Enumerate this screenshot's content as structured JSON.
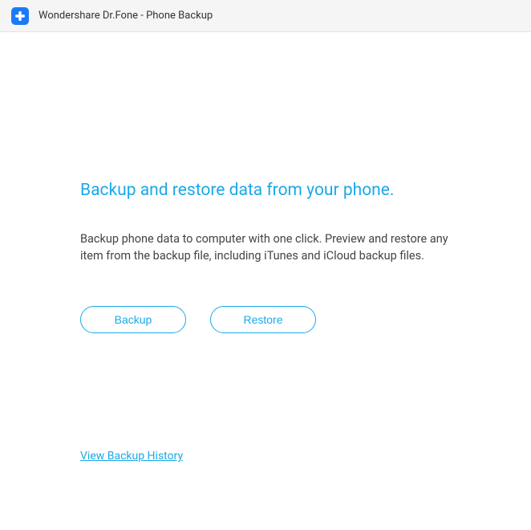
{
  "titlebar": {
    "app_title": "Wondershare Dr.Fone - Phone Backup"
  },
  "main": {
    "heading": "Backup and restore data from your phone.",
    "description": "Backup phone data to computer with one click. Preview and restore any item from the backup file, including iTunes and iCloud backup files.",
    "buttons": {
      "backup": "Backup",
      "restore": "Restore"
    },
    "history_link": "View Backup History"
  },
  "colors": {
    "accent": "#1aa9e8",
    "icon_bg": "#1a7af8"
  }
}
